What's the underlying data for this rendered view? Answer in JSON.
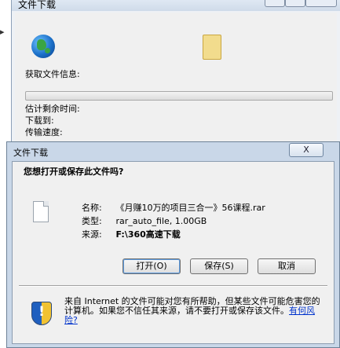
{
  "background_window": {
    "title": "文件下载",
    "getting_info_label": "获取文件信息:",
    "time_left_label": "估计剩余时间:",
    "download_to_label": "下载到:",
    "transfer_rate_label": "传输速度:"
  },
  "dialog": {
    "title": "文件下载",
    "close_label": "X",
    "question": "您想打开或保存此文件吗?",
    "file": {
      "name_label": "名称:",
      "name_value": "《月赚10万的项目三合一》56课程.rar",
      "type_label": "类型:",
      "type_value": "rar_auto_file, 1.00GB",
      "from_label": "来源:",
      "from_value": "F:\\360高速下载"
    },
    "buttons": {
      "open": "打开(O)",
      "save": "保存(S)",
      "cancel": "取消"
    },
    "warning_text": "来自 Internet 的文件可能对您有所帮助，但某些文件可能危害您的计算机。如果您不信任其来源，请不要打开或保存该文件。",
    "risk_link": "有何风险?"
  }
}
